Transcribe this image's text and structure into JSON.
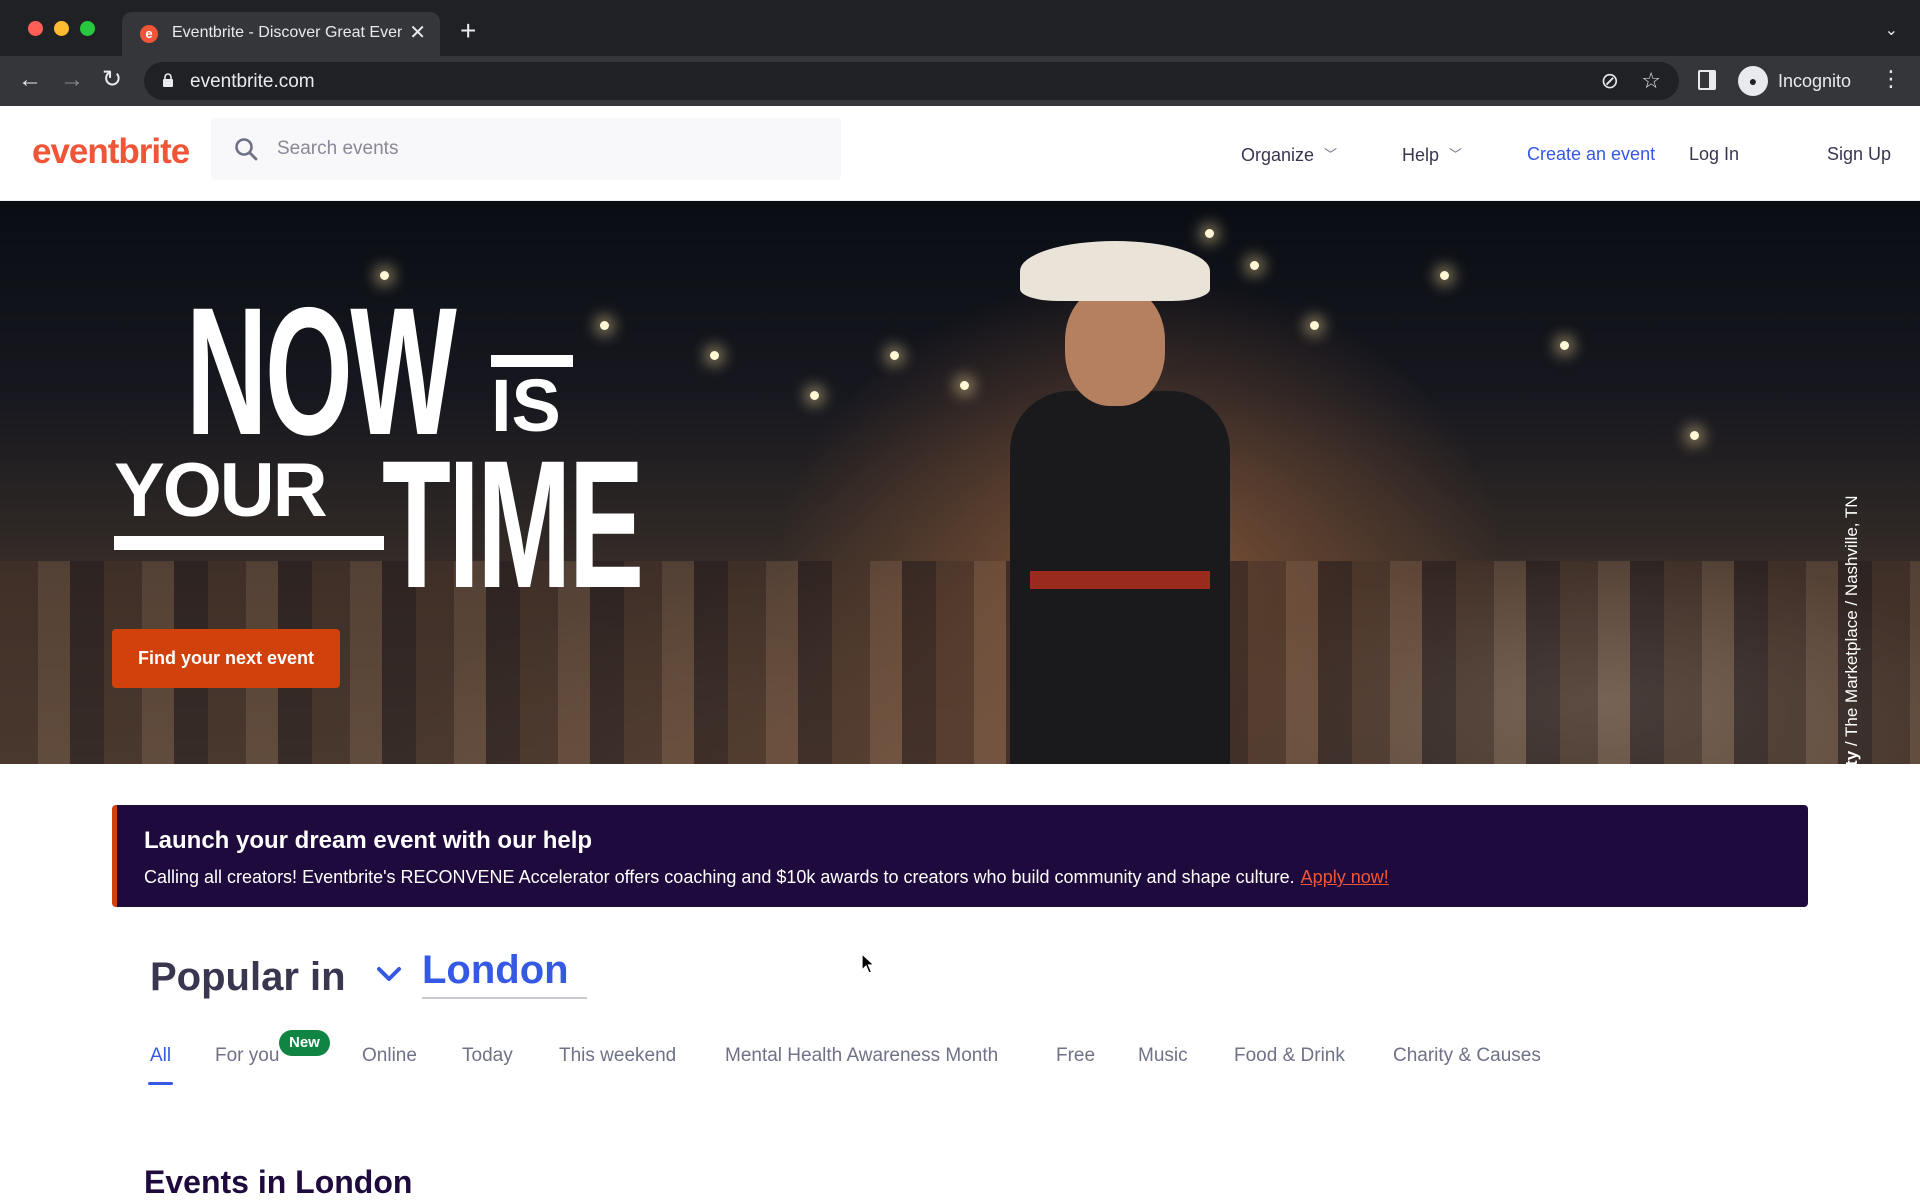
{
  "browser": {
    "tab_title": "Eventbrite - Discover Great Events",
    "url": "eventbrite.com",
    "profile_label": "Incognito"
  },
  "header": {
    "logo": "eventbrite",
    "search_placeholder": "Search events",
    "nav": {
      "organize": "Organize",
      "help": "Help",
      "create": "Create an event",
      "login": "Log In",
      "signup": "Sign Up"
    }
  },
  "hero": {
    "line_now": "NOW",
    "line_is": "IS",
    "line_your": "YOUR",
    "line_time": "TIME",
    "cta_label": "Find your next event",
    "credit_bold": "Country Dance Party",
    "credit_rest": " / The Marketplace / Nashville, TN"
  },
  "banner": {
    "title": "Launch your dream event with our help",
    "text": "Calling all creators! Eventbrite's RECONVENE Accelerator offers coaching and $10k awards to creators who build community and shape culture.",
    "link": "Apply now!"
  },
  "popular": {
    "prefix": "Popular in",
    "location": "London",
    "tabs": [
      {
        "label": "All"
      },
      {
        "label": "For you"
      },
      {
        "label": "Online"
      },
      {
        "label": "Today"
      },
      {
        "label": "This weekend"
      },
      {
        "label": "Mental Health Awareness Month"
      },
      {
        "label": "Free"
      },
      {
        "label": "Music"
      },
      {
        "label": "Food & Drink"
      },
      {
        "label": "Charity & Causes"
      }
    ],
    "new_badge": "New"
  },
  "events": {
    "heading": "Events in London"
  },
  "colors": {
    "brand": "#f05537",
    "accent_blue": "#3659e3",
    "cta": "#d1410c",
    "banner_bg": "#1e0a3c",
    "badge_green": "#0f8443"
  }
}
